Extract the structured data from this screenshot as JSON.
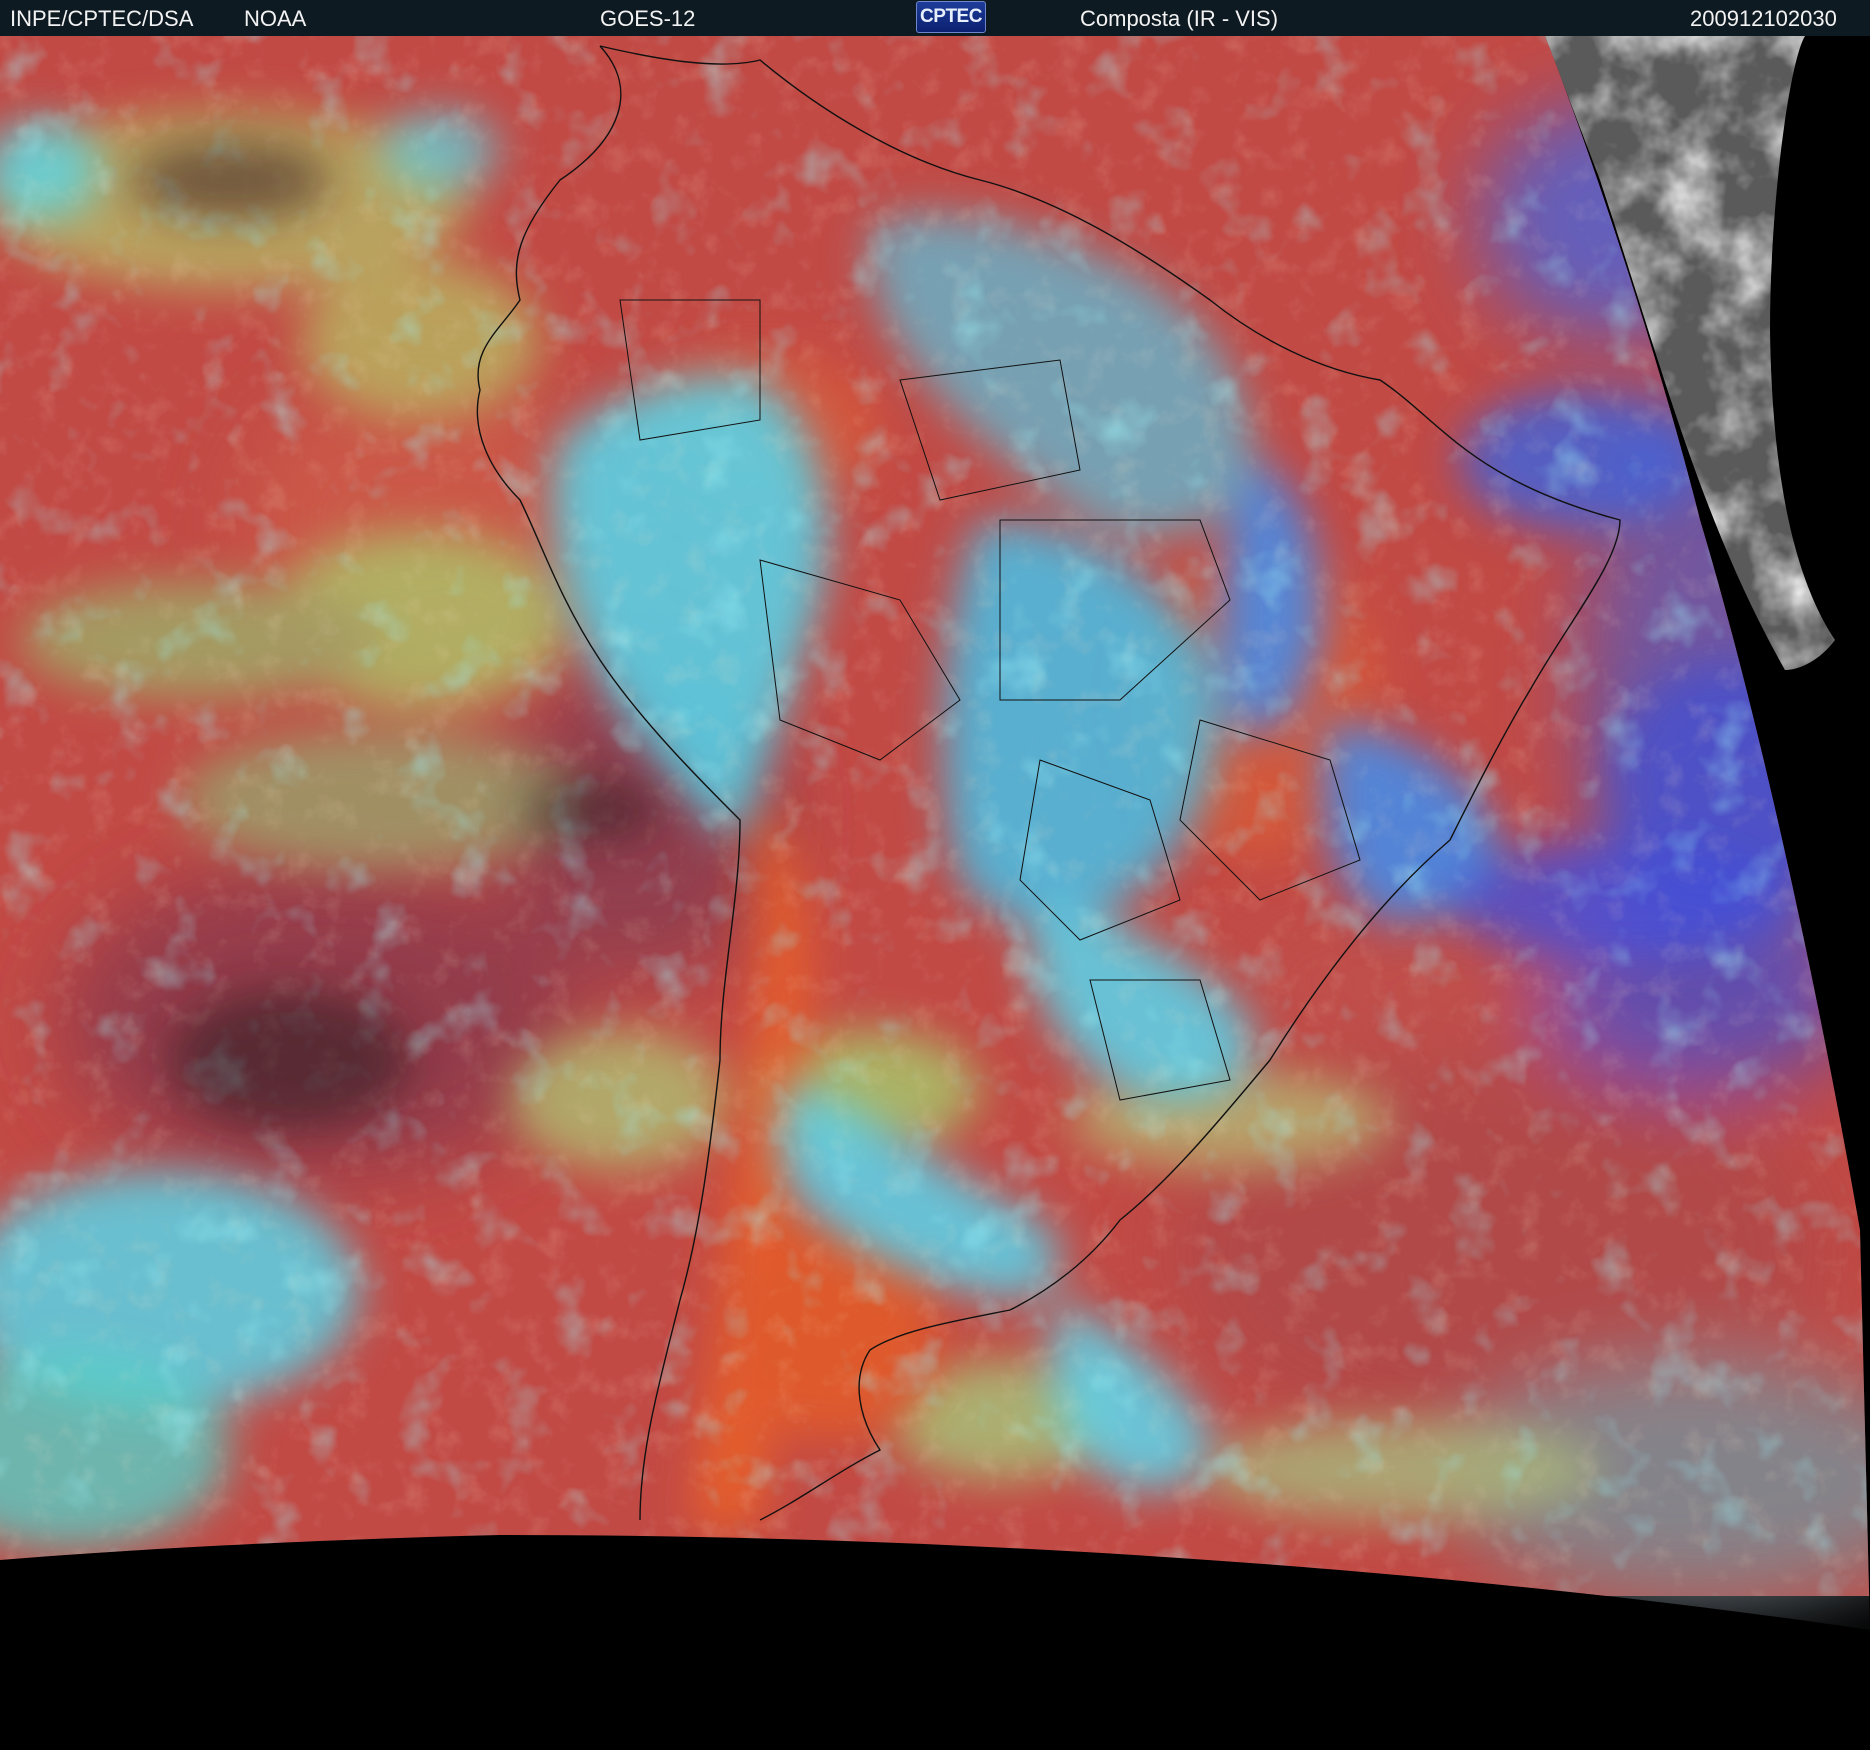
{
  "header": {
    "institution": "INPE/CPTEC/DSA",
    "agency": "NOAA",
    "satellite": "GOES-12",
    "logo_text": "CPTEC",
    "product": "Composta (IR - VIS)",
    "timestamp": "200912102030"
  },
  "colors": {
    "header_bg": "#0d1a22",
    "ocean_base": "#c24a45",
    "cloud_cyan": "#4fe3f2",
    "cloud_blue": "#3f63e6",
    "warm_orange": "#e9622c",
    "low_cloud_green": "#b6c86a",
    "space_black": "#000000"
  }
}
